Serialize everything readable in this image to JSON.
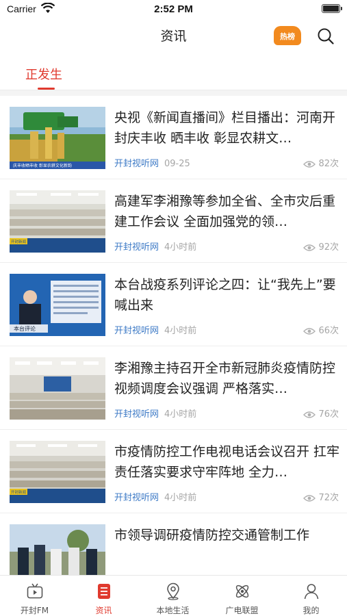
{
  "status": {
    "carrier": "Carrier",
    "time": "2:52 PM"
  },
  "nav": {
    "title": "资讯",
    "hot_badge": "热榜"
  },
  "tabs": [
    {
      "label": "正发生",
      "active": true
    }
  ],
  "articles": [
    {
      "title": "央视《新闻直播间》栏目播出：河南开封庆丰收 晒丰收 彰显农耕文…",
      "source": "开封视听网",
      "time": "09-25",
      "views": "82次",
      "thumb_caption": "庆丰收晒丰收 彰显农耕文化新韵"
    },
    {
      "title": "高建军李湘豫等参加全省、全市灾后重建工作会议 全面加强党的领…",
      "source": "开封视听网",
      "time": "4小时前",
      "views": "92次",
      "thumb_caption": "开封新闻"
    },
    {
      "title": "本台战疫系列评论之四：让“我先上”要喊出来",
      "source": "开封视听网",
      "time": "4小时前",
      "views": "66次",
      "thumb_caption": "本台评论"
    },
    {
      "title": "李湘豫主持召开全市新冠肺炎疫情防控视频调度会议强调 严格落实…",
      "source": "开封视听网",
      "time": "4小时前",
      "views": "76次",
      "thumb_caption": ""
    },
    {
      "title": "市疫情防控工作电视电话会议召开 扛牢责任落实要求守牢阵地 全力…",
      "source": "开封视听网",
      "time": "4小时前",
      "views": "72次",
      "thumb_caption": "开封新闻"
    },
    {
      "title": "市领导调研疫情防控交通管制工作",
      "source": "",
      "time": "",
      "views": "",
      "thumb_caption": ""
    }
  ],
  "bottom_nav": [
    {
      "label": "开封FM",
      "icon": "tv-icon",
      "active": false
    },
    {
      "label": "资讯",
      "icon": "news-list-icon",
      "active": true
    },
    {
      "label": "本地生活",
      "icon": "location-pin-icon",
      "active": false
    },
    {
      "label": "广电联盟",
      "icon": "atom-icon",
      "active": false
    },
    {
      "label": "我的",
      "icon": "person-icon",
      "active": false
    }
  ],
  "colors": {
    "accent": "#e03a2e",
    "source_blue": "#3d7ac6",
    "meta_gray": "#a5a5a5",
    "hot_orange": "#f28a1e"
  }
}
